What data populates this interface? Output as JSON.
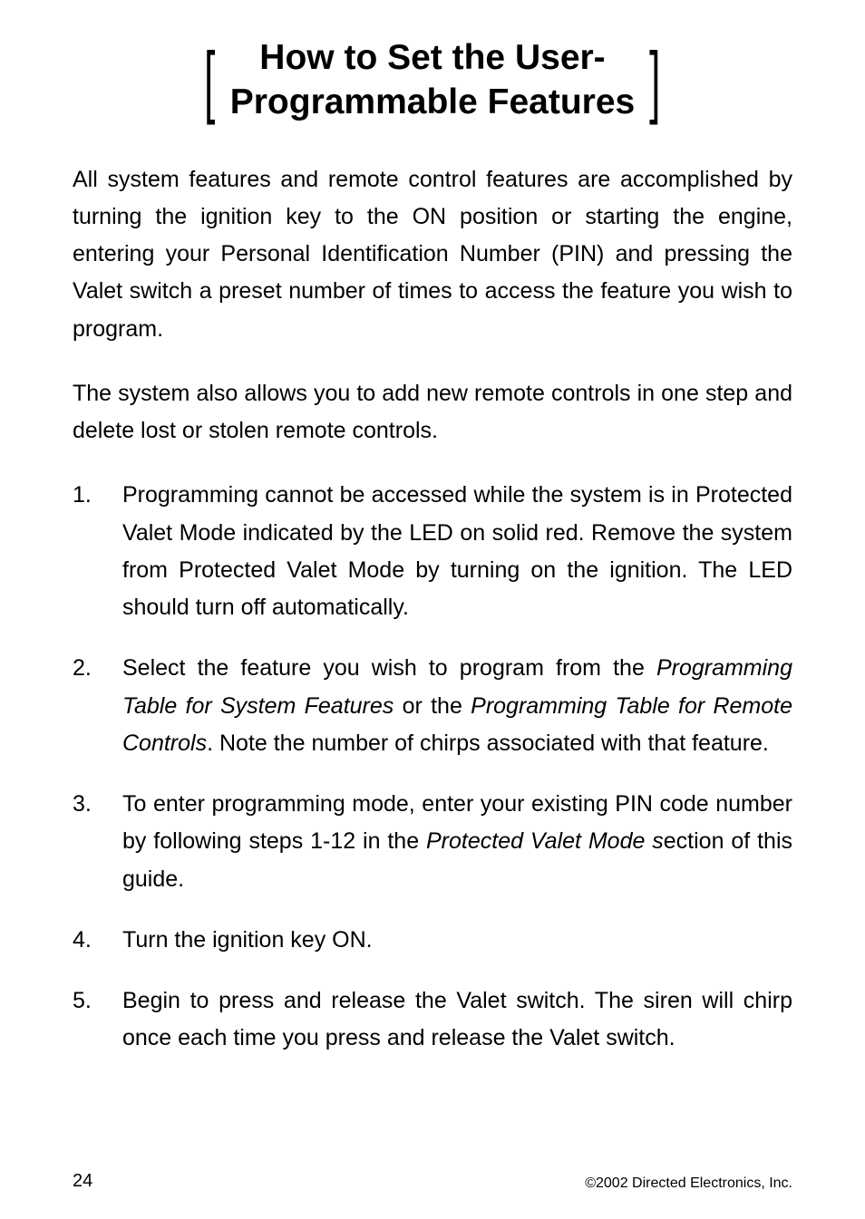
{
  "title": {
    "line1": "How to Set the User-",
    "line2": "Programmable Features"
  },
  "para1": "All system features and remote control features are accomplished by turning the ignition key to the ON position or starting the engine, entering your Personal Identification Number (PIN) and pressing the Valet switch a preset number of times to access the feature you wish to program.",
  "para2": "The system also allows you to add new remote controls in one step and delete lost or stolen remote controls.",
  "list": [
    {
      "num": "1.",
      "text": "Programming cannot be accessed while the system is in Protected Valet Mode indicated by the LED on solid red. Remove the system from Protected Valet Mode by turning on the ignition. The LED should turn off automatically."
    },
    {
      "num": "2.",
      "pre": "Select the feature you wish to program from the ",
      "i1": "Programming Table for System Features",
      "mid": " or the ",
      "i2": "Programming Table for Remote Controls",
      "post": ". Note the number of chirps associated with that feature."
    },
    {
      "num": "3.",
      "pre": "To enter programming mode, enter your existing PIN code number by following steps 1-12 in the ",
      "i1": "Protected Valet Mode ",
      "i2_part": "s",
      "post": "ection of this guide."
    },
    {
      "num": "4.",
      "text": "Turn the ignition key ON."
    },
    {
      "num": "5.",
      "text": "Begin to press and release the Valet switch. The siren will chirp once each time you press and release the Valet switch."
    }
  ],
  "footer": {
    "page": "24",
    "copyright": "©2002 Directed Electronics, Inc."
  }
}
